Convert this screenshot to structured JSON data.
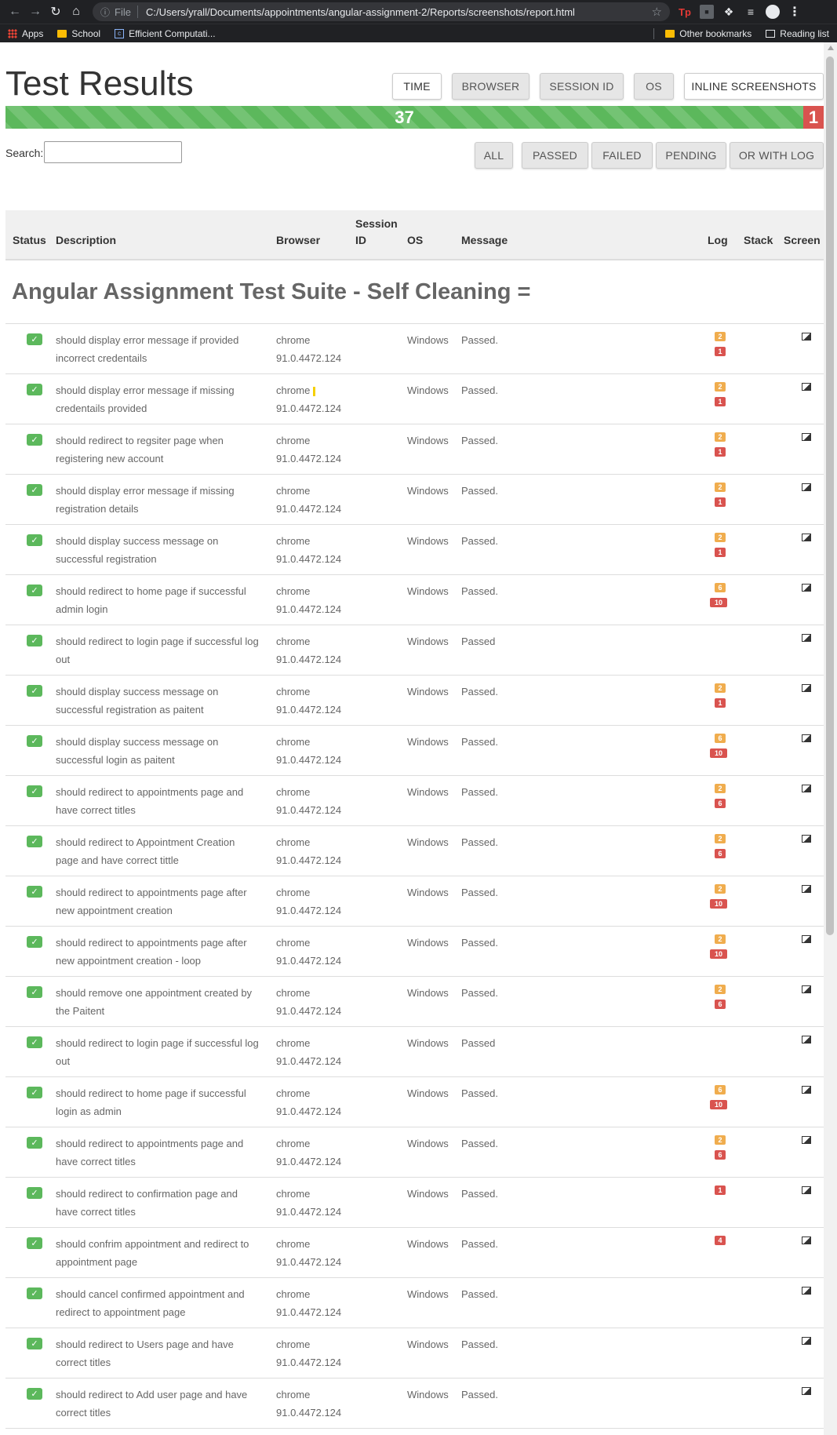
{
  "browser": {
    "url_scheme": "File",
    "url": "C:/Users/yrall/Documents/appointments/angular-assignment-2/Reports/screenshots/report.html",
    "bookmarks": [
      "Apps",
      "School",
      "Efficient Computati..."
    ],
    "bookmarks_right": [
      "Other bookmarks",
      "Reading list"
    ]
  },
  "page": {
    "title": "Test Results",
    "toggle_buttons": [
      "TIME",
      "BROWSER",
      "SESSION ID",
      "OS",
      "INLINE SCREENSHOTS"
    ],
    "progress": {
      "passed": "37",
      "failed": "1",
      "passed_count": 37,
      "failed_count": 1
    },
    "search_label": "Search:",
    "search_value": "",
    "filter_buttons": [
      "ALL",
      "PASSED",
      "FAILED",
      "PENDING",
      "OR WITH LOG"
    ],
    "columns": {
      "status": "Status",
      "description": "Description",
      "browser": "Browser",
      "session_line1": "Session",
      "session_line2": "ID",
      "os": "OS",
      "message": "Message",
      "log": "Log",
      "stack": "Stack",
      "screen": "Screen"
    },
    "suite_title": "Angular Assignment Test Suite - Self Cleaning =",
    "rows": [
      {
        "desc1": "should display error message if provided",
        "desc2": "incorrect credentails",
        "browser1": "chrome",
        "browser2": "91.0.4472.124",
        "os": "Windows",
        "message": "Passed.",
        "warn": "2",
        "severe": "1"
      },
      {
        "desc1": "should display error message if missing",
        "desc2": "credentails provided",
        "browser1": "chrome",
        "browser2": "91.0.4472.124",
        "os": "Windows",
        "message": "Passed.",
        "warn": "2",
        "severe": "1"
      },
      {
        "desc1": "should redirect to regsiter page when",
        "desc2": "registering new account",
        "browser1": "chrome",
        "browser2": "91.0.4472.124",
        "os": "Windows",
        "message": "Passed.",
        "warn": "2",
        "severe": "1"
      },
      {
        "desc1": "should display error message if missing",
        "desc2": "registration details",
        "browser1": "chrome",
        "browser2": "91.0.4472.124",
        "os": "Windows",
        "message": "Passed.",
        "warn": "2",
        "severe": "1"
      },
      {
        "desc1": "should display success message on",
        "desc2": "successful registration",
        "browser1": "chrome",
        "browser2": "91.0.4472.124",
        "os": "Windows",
        "message": "Passed.",
        "warn": "2",
        "severe": "1"
      },
      {
        "desc1": "should redirect to home page if successful",
        "desc2": "admin login",
        "browser1": "chrome",
        "browser2": "91.0.4472.124",
        "os": "Windows",
        "message": "Passed.",
        "warn": "6",
        "severe": "10"
      },
      {
        "desc1": "should redirect to login page if successful log",
        "desc2": "out",
        "browser1": "chrome",
        "browser2": "91.0.4472.124",
        "os": "Windows",
        "message": "Passed",
        "warn": "",
        "severe": ""
      },
      {
        "desc1": "should display success message on",
        "desc2": "successful registration as paitent",
        "browser1": "chrome",
        "browser2": "91.0.4472.124",
        "os": "Windows",
        "message": "Passed.",
        "warn": "2",
        "severe": "1"
      },
      {
        "desc1": "should display success message on",
        "desc2": "successful login as paitent",
        "browser1": "chrome",
        "browser2": "91.0.4472.124",
        "os": "Windows",
        "message": "Passed.",
        "warn": "6",
        "severe": "10"
      },
      {
        "desc1": "should redirect to appointments page and",
        "desc2": "have correct titles",
        "browser1": "chrome",
        "browser2": "91.0.4472.124",
        "os": "Windows",
        "message": "Passed.",
        "warn": "2",
        "severe": "6"
      },
      {
        "desc1": "should redirect to Appointment Creation",
        "desc2": "page and have correct tittle",
        "browser1": "chrome",
        "browser2": "91.0.4472.124",
        "os": "Windows",
        "message": "Passed.",
        "warn": "2",
        "severe": "6"
      },
      {
        "desc1": "should redirect to appointments page after",
        "desc2": "new appointment creation",
        "browser1": "chrome",
        "browser2": "91.0.4472.124",
        "os": "Windows",
        "message": "Passed.",
        "warn": "2",
        "severe": "10"
      },
      {
        "desc1": "should redirect to appointments page after",
        "desc2": "new appointment creation - loop",
        "browser1": "chrome",
        "browser2": "91.0.4472.124",
        "os": "Windows",
        "message": "Passed.",
        "warn": "2",
        "severe": "10"
      },
      {
        "desc1": "should remove one appointment created by",
        "desc2": "the Paitent",
        "browser1": "chrome",
        "browser2": "91.0.4472.124",
        "os": "Windows",
        "message": "Passed.",
        "warn": "2",
        "severe": "6"
      },
      {
        "desc1": "should redirect to login page if successful log",
        "desc2": "out",
        "browser1": "chrome",
        "browser2": "91.0.4472.124",
        "os": "Windows",
        "message": "Passed",
        "warn": "",
        "severe": ""
      },
      {
        "desc1": "should redirect to home page if successful",
        "desc2": "login as admin",
        "browser1": "chrome",
        "browser2": "91.0.4472.124",
        "os": "Windows",
        "message": "Passed.",
        "warn": "6",
        "severe": "10"
      },
      {
        "desc1": "should redirect to appointments page and",
        "desc2": "have correct titles",
        "browser1": "chrome",
        "browser2": "91.0.4472.124",
        "os": "Windows",
        "message": "Passed.",
        "warn": "2",
        "severe": "6"
      },
      {
        "desc1": "should redirect to confirmation page and",
        "desc2": "have correct titles",
        "browser1": "chrome",
        "browser2": "91.0.4472.124",
        "os": "Windows",
        "message": "Passed.",
        "warn": "",
        "severe": "1"
      },
      {
        "desc1": "should confrim appointment and redirect to",
        "desc2": "appointment page",
        "browser1": "chrome",
        "browser2": "91.0.4472.124",
        "os": "Windows",
        "message": "Passed.",
        "warn": "",
        "severe": "4"
      },
      {
        "desc1": "should cancel confirmed appointment and",
        "desc2": "redirect to appointment page",
        "browser1": "chrome",
        "browser2": "91.0.4472.124",
        "os": "Windows",
        "message": "Passed.",
        "warn": "",
        "severe": ""
      },
      {
        "desc1": "should redirect to Users page and have",
        "desc2": "correct titles",
        "browser1": "chrome",
        "browser2": "91.0.4472.124",
        "os": "Windows",
        "message": "Passed.",
        "warn": "",
        "severe": ""
      },
      {
        "desc1": "should redirect to Add user page and have",
        "desc2": "correct titles",
        "browser1": "chrome",
        "browser2": "91.0.4472.124",
        "os": "Windows",
        "message": "Passed.",
        "warn": "",
        "severe": ""
      }
    ]
  },
  "colors": {
    "passed": "#5cb85c",
    "failed": "#d9534f",
    "warning_badge": "#f0ad4e",
    "severe_badge": "#d9534f"
  }
}
